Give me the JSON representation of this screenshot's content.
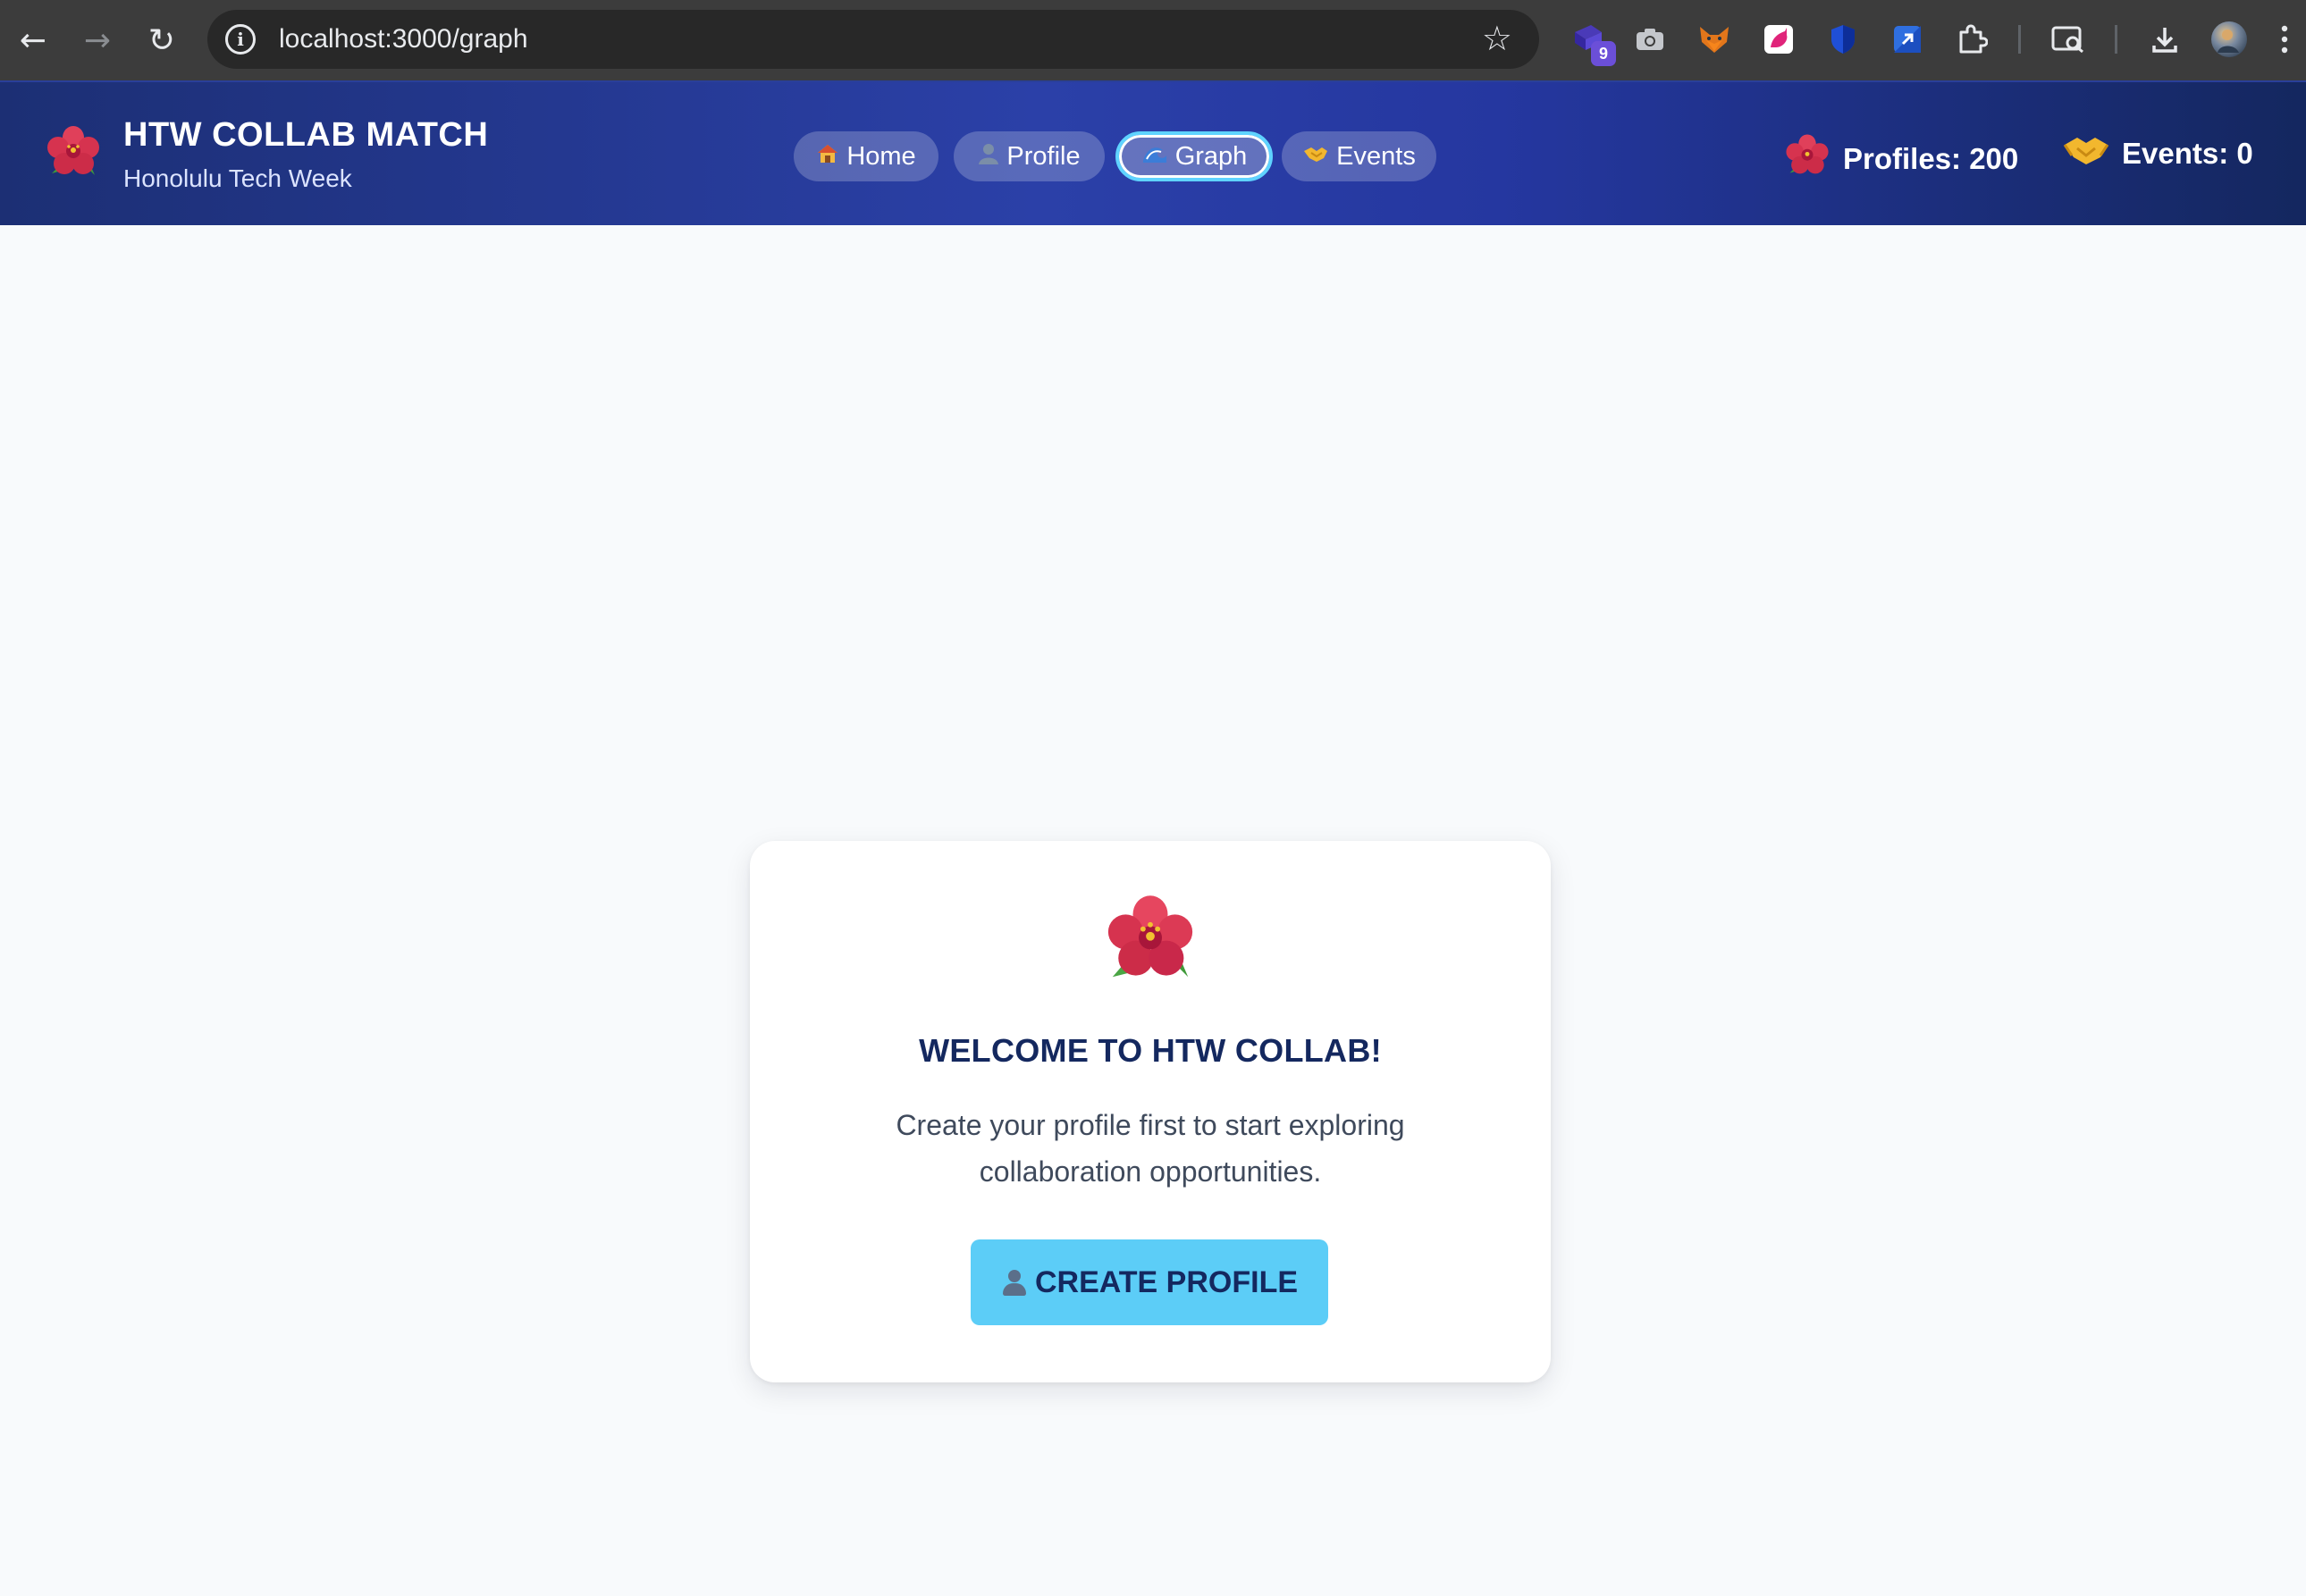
{
  "browser": {
    "url": "localhost:3000/graph",
    "extension_badge": "9",
    "extensions": [
      "stack-extension-icon",
      "camera-icon",
      "fox-icon",
      "unicorn-icon",
      "shield-icon",
      "arrow-box-icon",
      "puzzle-icon",
      "search-tab-icon",
      "download-icon",
      "profile-avatar"
    ]
  },
  "header": {
    "title": "HTW COLLAB MATCH",
    "subtitle": "Honolulu Tech Week",
    "nav": [
      {
        "label": "Home",
        "icon": "house-icon"
      },
      {
        "label": "Profile",
        "icon": "person-icon"
      },
      {
        "label": "Graph",
        "icon": "wave-icon",
        "active": true
      },
      {
        "label": "Events",
        "icon": "handshake-icon"
      }
    ],
    "stats": {
      "profiles": "Profiles: 200",
      "events": "Events: 0"
    }
  },
  "main": {
    "card_title": "WELCOME TO HTW COLLAB!",
    "card_text": "Create your profile first to start exploring collaboration opportunities.",
    "cta_label": "CREATE PROFILE"
  },
  "colors": {
    "header_gradient_start": "#1c2f74",
    "header_gradient_mid": "#2b40a8",
    "accent": "#5ccdf7",
    "title_navy": "#14285f",
    "page_bg": "#f8fafc"
  }
}
